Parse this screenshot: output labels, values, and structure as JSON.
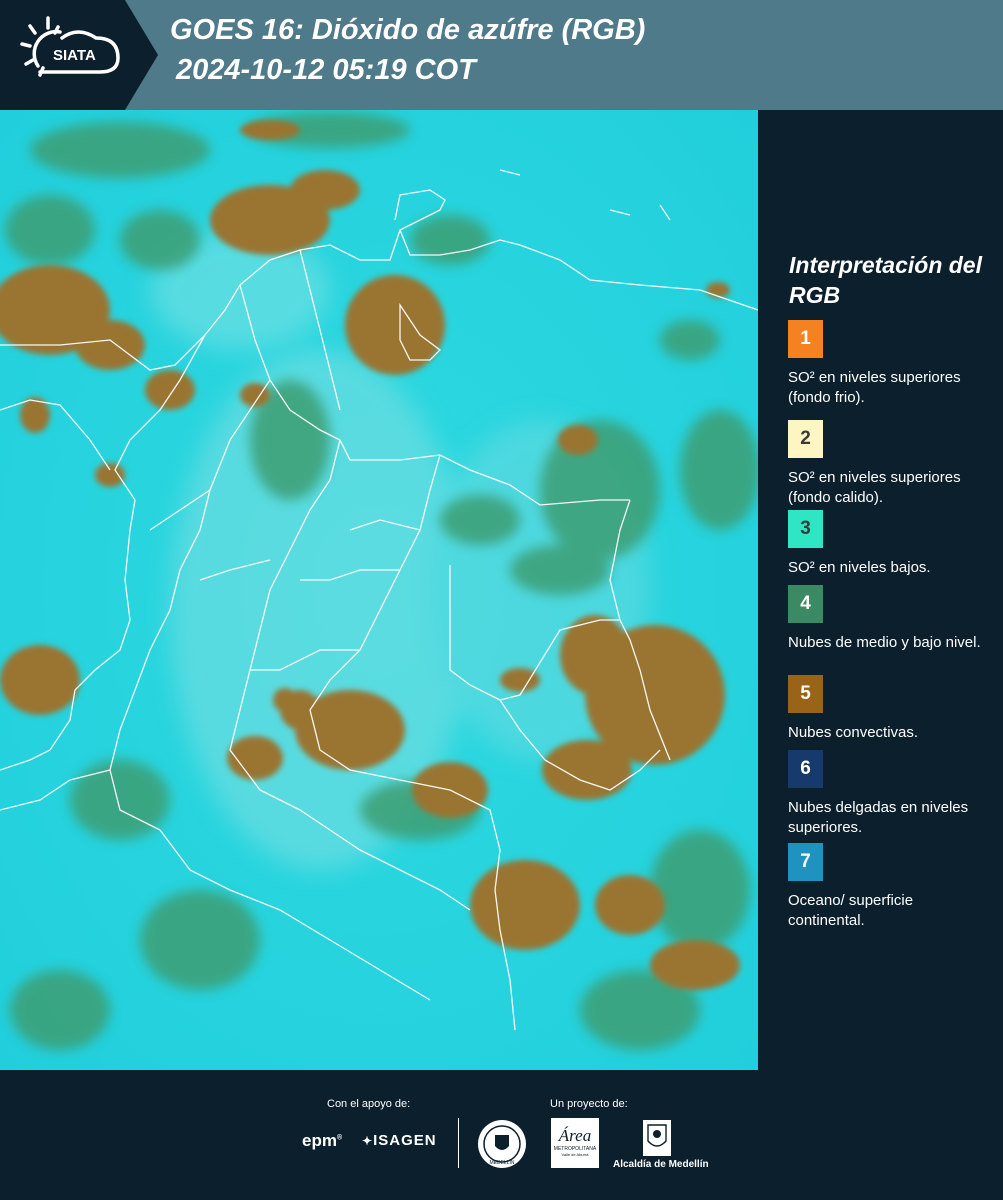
{
  "header": {
    "logo_text": "SIATA",
    "title_line1": "GOES 16: Dióxido de azúfre (RGB)",
    "title_line2": "2024-10-12 05:19 COT"
  },
  "legend": {
    "title": "Interpretación del RGB",
    "items": [
      {
        "number": "1",
        "color": "#f58220",
        "text": "SO² en niveles superiores (fondo frio)."
      },
      {
        "number": "2",
        "color": "#fdf6c3",
        "text": "SO² en niveles superiores (fondo calido)."
      },
      {
        "number": "3",
        "color": "#2ee6c4",
        "text": "SO² en niveles bajos."
      },
      {
        "number": "4",
        "color": "#3b8a63",
        "text": "Nubes de medio y bajo nivel."
      },
      {
        "number": "5",
        "color": "#9a6418",
        "text": "Nubes convectivas."
      },
      {
        "number": "6",
        "color": "#163a6b",
        "text": "Nubes delgadas en niveles superiores."
      },
      {
        "number": "7",
        "color": "#1e93c0",
        "text": "Oceano/ superficie continental."
      }
    ]
  },
  "footer": {
    "support_label": "Con el apoyo de:",
    "project_label": "Un proyecto de:",
    "sponsor1": "epm",
    "sponsor2": "ISAGEN",
    "partner1": "MEDELLÍN",
    "partner2_name": "Área",
    "partner2_sub": "METROPOLITANA",
    "partner2_sub2": "Valle de Aburrá",
    "partner3": "Alcaldía de Medellín"
  },
  "colors": {
    "header_bg": "#4f7a8a",
    "page_bg": "#0c1f2c",
    "map_base": "#1fd6df",
    "cloud_convective": "#9a7433",
    "cloud_low": "#3d9e73"
  }
}
